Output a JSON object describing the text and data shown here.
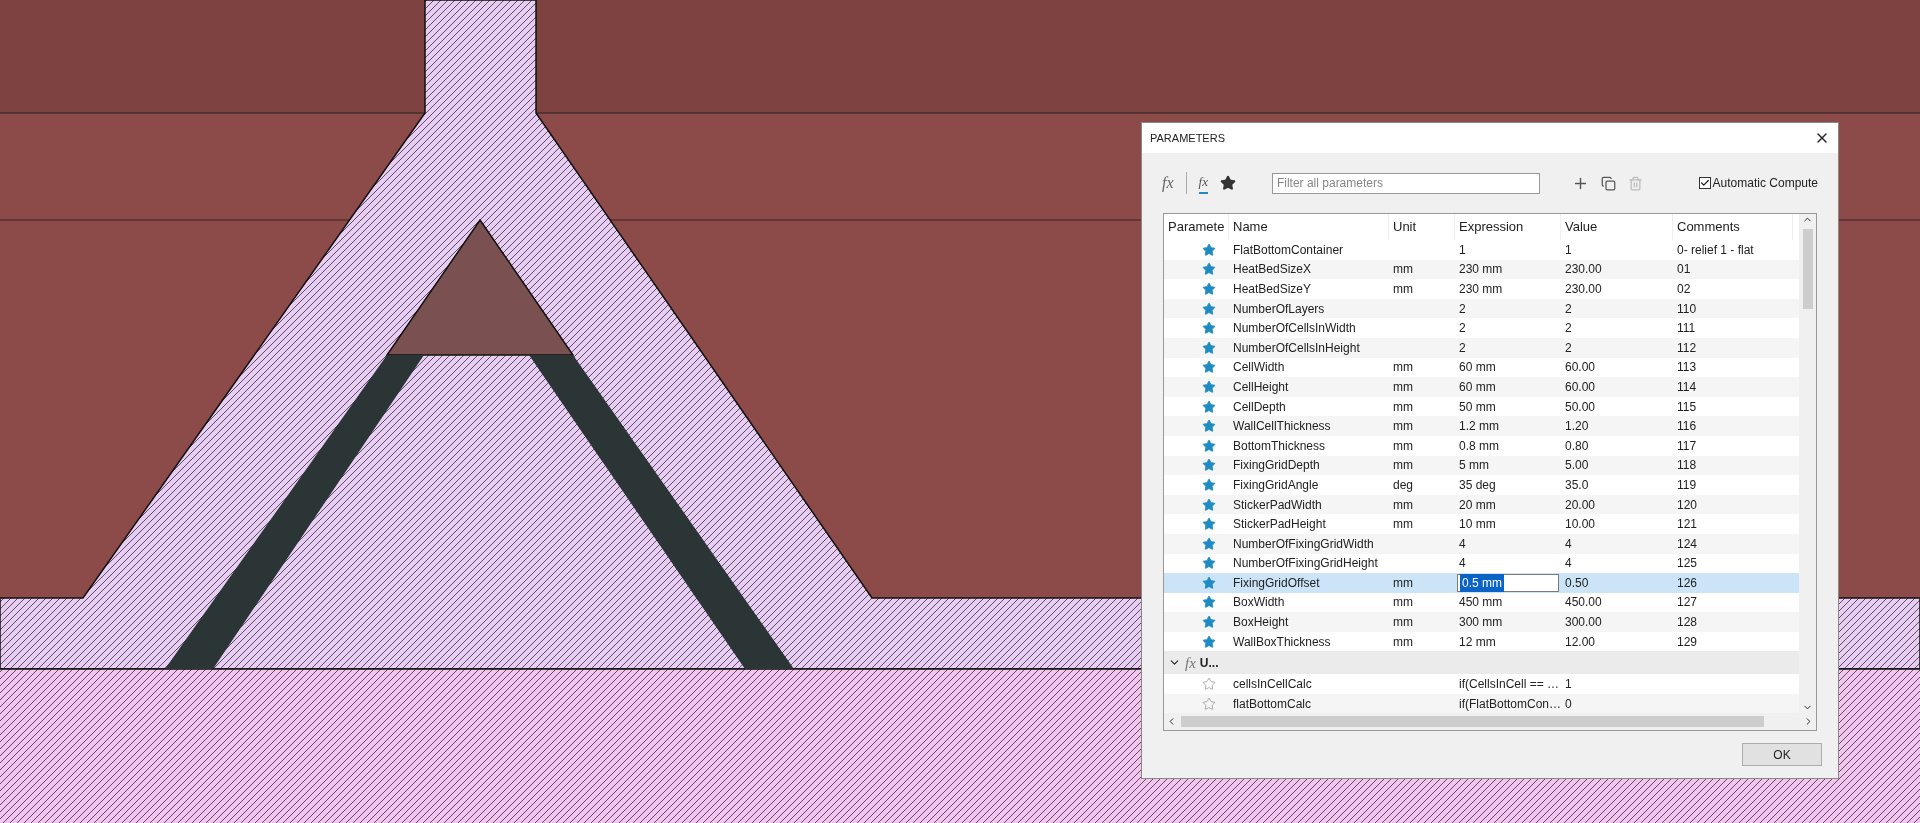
{
  "dialog": {
    "title": "PARAMETERS",
    "toolbar": {
      "function_glyph": "fx",
      "user_function_glyph": "fx",
      "filter": {
        "placeholder": "Filter all parameters"
      },
      "delete_disabled": true,
      "automatic_compute": {
        "label": "Automatic Compute",
        "checked": true
      }
    },
    "table": {
      "columns": [
        "Paramete",
        "Name",
        "Unit",
        "Expression",
        "Value",
        "Comments"
      ],
      "rows": [
        {
          "kind": "param",
          "favorite": true,
          "selected": false,
          "name": "FlatBottomContainer",
          "unit": "",
          "expression": "1",
          "value": "1",
          "comment": "0- relief 1 - flat"
        },
        {
          "kind": "param",
          "favorite": true,
          "selected": false,
          "name": "HeatBedSizeX",
          "unit": "mm",
          "expression": "230 mm",
          "value": "230.00",
          "comment": "01"
        },
        {
          "kind": "param",
          "favorite": true,
          "selected": false,
          "name": "HeatBedSizeY",
          "unit": "mm",
          "expression": "230 mm",
          "value": "230.00",
          "comment": "02"
        },
        {
          "kind": "param",
          "favorite": true,
          "selected": false,
          "name": "NumberOfLayers",
          "unit": "",
          "expression": "2",
          "value": "2",
          "comment": "110"
        },
        {
          "kind": "param",
          "favorite": true,
          "selected": false,
          "name": "NumberOfCellsInWidth",
          "unit": "",
          "expression": "2",
          "value": "2",
          "comment": "111"
        },
        {
          "kind": "param",
          "favorite": true,
          "selected": false,
          "name": "NumberOfCellsInHeight",
          "unit": "",
          "expression": "2",
          "value": "2",
          "comment": "112"
        },
        {
          "kind": "param",
          "favorite": true,
          "selected": false,
          "name": "CellWidth",
          "unit": "mm",
          "expression": "60 mm",
          "value": "60.00",
          "comment": "113"
        },
        {
          "kind": "param",
          "favorite": true,
          "selected": false,
          "name": "CellHeight",
          "unit": "mm",
          "expression": "60 mm",
          "value": "60.00",
          "comment": "114"
        },
        {
          "kind": "param",
          "favorite": true,
          "selected": false,
          "name": "CellDepth",
          "unit": "mm",
          "expression": "50 mm",
          "value": "50.00",
          "comment": "115"
        },
        {
          "kind": "param",
          "favorite": true,
          "selected": false,
          "name": "WallCellThickness",
          "unit": "mm",
          "expression": "1.2 mm",
          "value": "1.20",
          "comment": "116"
        },
        {
          "kind": "param",
          "favorite": true,
          "selected": false,
          "name": "BottomThickness",
          "unit": "mm",
          "expression": "0.8 mm",
          "value": "0.80",
          "comment": "117"
        },
        {
          "kind": "param",
          "favorite": true,
          "selected": false,
          "name": "FixingGridDepth",
          "unit": "mm",
          "expression": "5 mm",
          "value": "5.00",
          "comment": "118"
        },
        {
          "kind": "param",
          "favorite": true,
          "selected": false,
          "name": "FixingGridAngle",
          "unit": "deg",
          "expression": "35 deg",
          "value": "35.0",
          "comment": "119"
        },
        {
          "kind": "param",
          "favorite": true,
          "selected": false,
          "name": "StickerPadWidth",
          "unit": "mm",
          "expression": "20 mm",
          "value": "20.00",
          "comment": "120"
        },
        {
          "kind": "param",
          "favorite": true,
          "selected": false,
          "name": "StickerPadHeight",
          "unit": "mm",
          "expression": "10 mm",
          "value": "10.00",
          "comment": "121"
        },
        {
          "kind": "param",
          "favorite": true,
          "selected": false,
          "name": "NumberOfFixingGridWidth",
          "unit": "",
          "expression": "4",
          "value": "4",
          "comment": "124"
        },
        {
          "kind": "param",
          "favorite": true,
          "selected": false,
          "name": "NumberOfFixingGridHeight",
          "unit": "",
          "expression": "4",
          "value": "4",
          "comment": "125"
        },
        {
          "kind": "param",
          "favorite": true,
          "selected": true,
          "name": "FixingGridOffset",
          "unit": "mm",
          "expression": "0.5 mm",
          "value": "0.50",
          "comment": "126"
        },
        {
          "kind": "param",
          "favorite": true,
          "selected": false,
          "name": "BoxWidth",
          "unit": "mm",
          "expression": "450 mm",
          "value": "450.00",
          "comment": "127"
        },
        {
          "kind": "param",
          "favorite": true,
          "selected": false,
          "name": "BoxHeight",
          "unit": "mm",
          "expression": "300 mm",
          "value": "300.00",
          "comment": "128"
        },
        {
          "kind": "param",
          "favorite": true,
          "selected": false,
          "name": "WallBoxThickness",
          "unit": "mm",
          "expression": "12 mm",
          "value": "12.00",
          "comment": "129"
        },
        {
          "kind": "group",
          "expanded": true,
          "selected": false,
          "glyph": "fx",
          "label": "U..."
        },
        {
          "kind": "param",
          "favorite": false,
          "selected": false,
          "name": "cellsInCellCalc",
          "unit": "",
          "expression": "if(CellsInCell == …",
          "value": "1",
          "comment": ""
        },
        {
          "kind": "param",
          "favorite": false,
          "selected": false,
          "name": "flatBottomCalc",
          "unit": "",
          "expression": "if(FlatBottomCon…",
          "value": "0",
          "comment": ""
        }
      ]
    },
    "buttons": [
      {
        "label": "OK"
      }
    ]
  }
}
